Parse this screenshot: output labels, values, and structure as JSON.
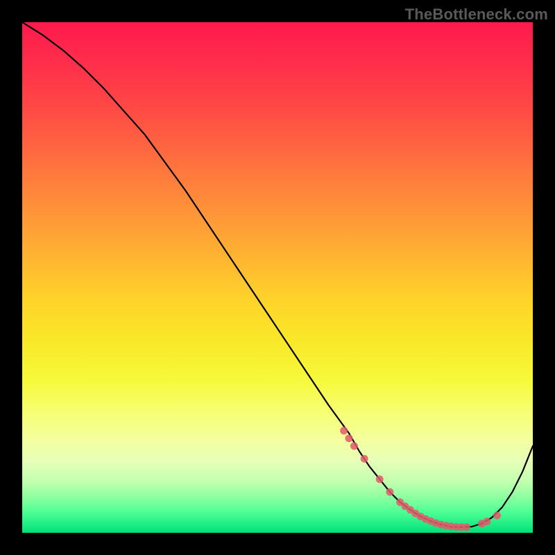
{
  "watermark": "TheBottleneck.com",
  "chart_data": {
    "type": "line",
    "title": "",
    "xlabel": "",
    "ylabel": "",
    "xlim": [
      0,
      100
    ],
    "ylim": [
      0,
      100
    ],
    "grid": false,
    "background": "red-yellow-green vertical gradient",
    "series": [
      {
        "name": "curve",
        "color": "#000000",
        "x": [
          0,
          4,
          8,
          12,
          16,
          20,
          24,
          28,
          32,
          36,
          40,
          44,
          48,
          52,
          56,
          60,
          64,
          66,
          68,
          70,
          72,
          74,
          76,
          78,
          80,
          82,
          84,
          86,
          88,
          90,
          92,
          94,
          96,
          98,
          100
        ],
        "y": [
          100,
          97.5,
          94.5,
          91,
          87,
          82.5,
          78,
          72.5,
          67,
          61,
          55,
          49,
          43,
          37,
          31,
          25,
          19.5,
          16,
          13,
          10.5,
          8,
          6,
          4.5,
          3.2,
          2.3,
          1.6,
          1.2,
          1.1,
          1.2,
          1.8,
          3.0,
          5.0,
          8.0,
          12.0,
          17.0
        ]
      },
      {
        "name": "dots",
        "type": "scatter",
        "color": "#e25a6a",
        "x": [
          63,
          64,
          65,
          67,
          70,
          72,
          74,
          75,
          76,
          77,
          78,
          79,
          80,
          81,
          82,
          83,
          84,
          85,
          86,
          87,
          90,
          91,
          93
        ],
        "y": [
          20,
          18.5,
          17,
          14.5,
          10.5,
          8,
          6,
          5.2,
          4.5,
          3.8,
          3.2,
          2.7,
          2.3,
          1.9,
          1.6,
          1.4,
          1.25,
          1.15,
          1.1,
          1.1,
          1.8,
          2.2,
          3.4
        ]
      }
    ]
  }
}
